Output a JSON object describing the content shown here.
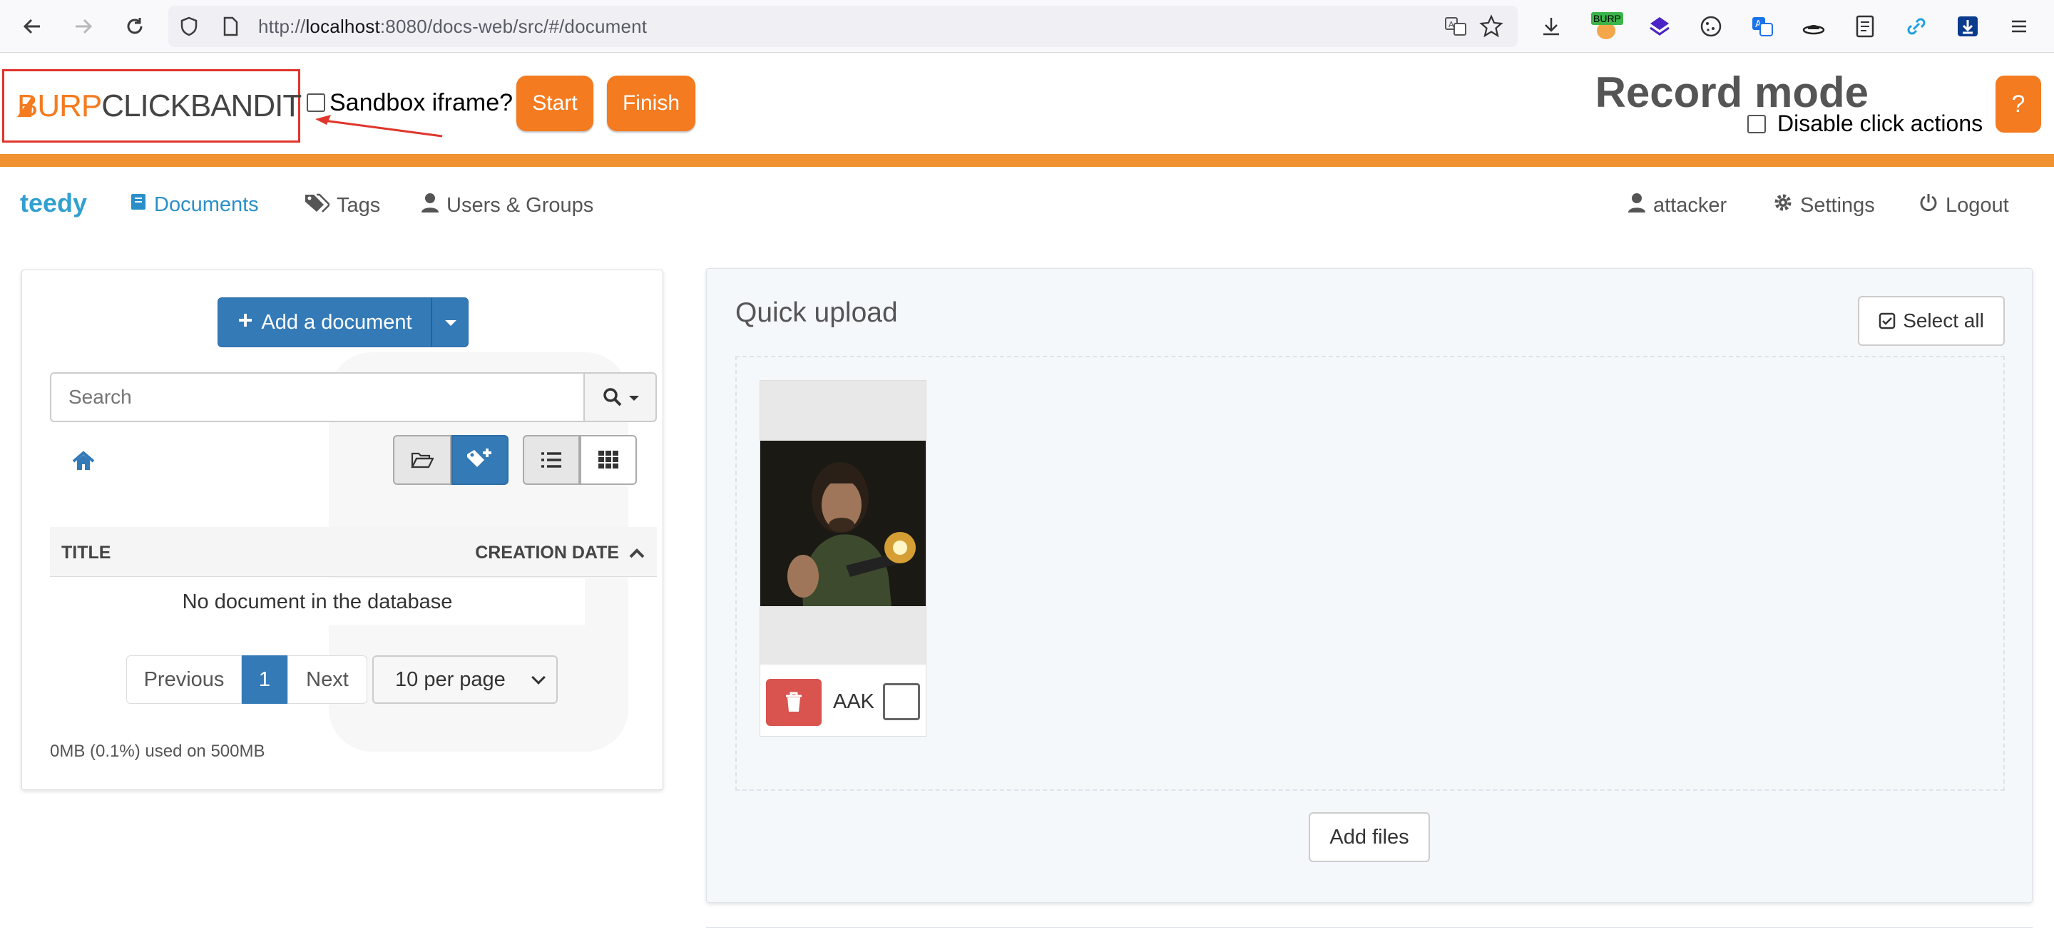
{
  "browser": {
    "url_prefix": "http://",
    "url_host": "localhost",
    "url_rest": ":8080/docs-web/src/#/document",
    "extension_badge": "BURP"
  },
  "clickbandit": {
    "logo_burp": "BURP",
    "logo_clickbandit": "CLICKBANDIT",
    "sandbox_label": "Sandbox iframe?",
    "start_label": "Start",
    "finish_label": "Finish",
    "mode_title": "Record mode",
    "disable_clicks_label": "Disable click actions",
    "help_label": "?",
    "accent_color": "#f47b20"
  },
  "nav": {
    "brand": "teedy",
    "documents": "Documents",
    "tags": "Tags",
    "users_groups": "Users & Groups",
    "user": "attacker",
    "settings": "Settings",
    "logout": "Logout"
  },
  "left": {
    "add_document": "Add a document",
    "search_placeholder": "Search",
    "col_title": "TITLE",
    "col_date": "CREATION DATE",
    "empty_message": "No document in the database",
    "prev": "Previous",
    "page": "1",
    "next": "Next",
    "per_page": "10 per page",
    "quota": "0MB (0.1%) used on 500MB"
  },
  "right": {
    "title": "Quick upload",
    "select_all": "Select all",
    "file_name": "AAK",
    "add_files": "Add files"
  }
}
